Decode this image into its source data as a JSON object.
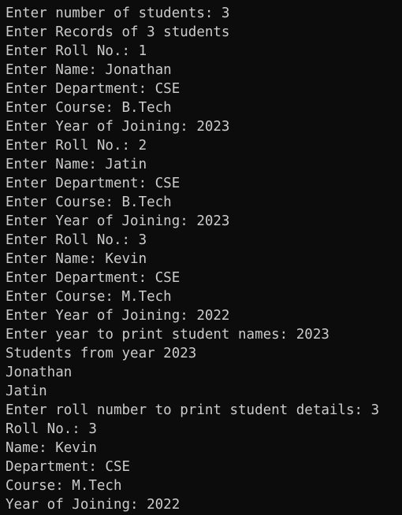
{
  "console": {
    "lines": [
      "Enter number of students: 3",
      "Enter Records of 3 students",
      "Enter Roll No.: 1",
      "Enter Name: Jonathan",
      "Enter Department: CSE",
      "Enter Course: B.Tech",
      "Enter Year of Joining: 2023",
      "Enter Roll No.: 2",
      "Enter Name: Jatin",
      "Enter Department: CSE",
      "Enter Course: B.Tech",
      "Enter Year of Joining: 2023",
      "Enter Roll No.: 3",
      "Enter Name: Kevin",
      "Enter Department: CSE",
      "Enter Course: M.Tech",
      "Enter Year of Joining: 2022",
      "Enter year to print student names: 2023",
      "Students from year 2023",
      "Jonathan",
      "Jatin",
      "Enter roll number to print student details: 3",
      "Roll No.: 3",
      "Name: Kevin",
      "Department: CSE",
      "Course: M.Tech",
      "Year of Joining: 2022"
    ]
  },
  "colors": {
    "background": "#0c0c0c",
    "text": "#cccccc"
  }
}
